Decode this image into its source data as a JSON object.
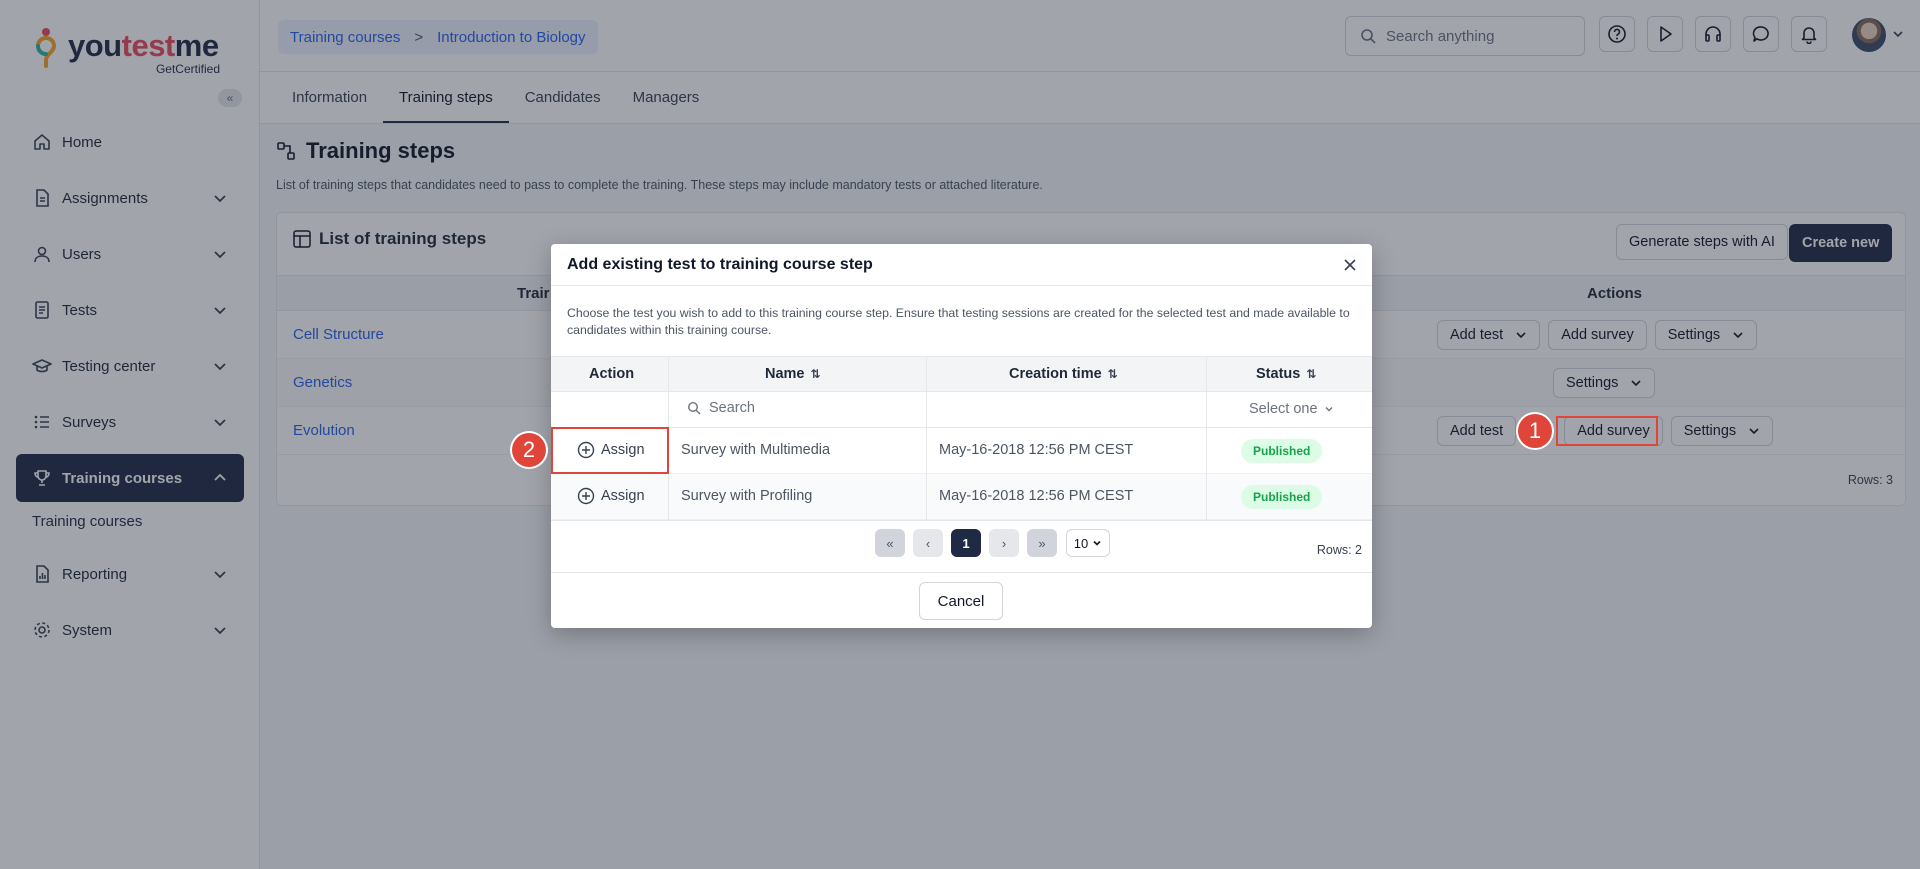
{
  "brand": {
    "logo_prefix": "you",
    "logo_mid": "test",
    "logo_suffix": "me",
    "sub": "GetCertified"
  },
  "sidebar": {
    "items": [
      {
        "label": "Home",
        "icon": "home-icon"
      },
      {
        "label": "Assignments",
        "icon": "document-icon"
      },
      {
        "label": "Users",
        "icon": "user-icon"
      },
      {
        "label": "Tests",
        "icon": "test-icon"
      },
      {
        "label": "Testing center",
        "icon": "graduation-cap-icon"
      },
      {
        "label": "Surveys",
        "icon": "list-icon"
      },
      {
        "label": "Training courses",
        "icon": "trophy-icon"
      },
      {
        "label": "Reporting",
        "icon": "report-icon"
      },
      {
        "label": "System",
        "icon": "gear-icon"
      }
    ],
    "sub_item": "Training courses"
  },
  "topbar": {
    "crumb1": "Training courses",
    "crumb_sep": ">",
    "crumb2": "Introduction to Biology",
    "search_placeholder": "Search anything"
  },
  "tabs": [
    "Information",
    "Training steps",
    "Candidates",
    "Managers"
  ],
  "page": {
    "title": "Training steps",
    "description": "List of training steps that candidates need to pass to complete the training. These steps may include mandatory tests or attached literature."
  },
  "card": {
    "title": "List of training steps",
    "generate_label": "Generate steps with AI",
    "create_label": "Create new",
    "col_training": "Trair",
    "col_actions": "Actions",
    "rows": [
      {
        "name": "Cell Structure"
      },
      {
        "name": "Genetics"
      },
      {
        "name": "Evolution"
      }
    ],
    "add_test": "Add test",
    "add_survey": "Add survey",
    "settings": "Settings",
    "rows_count": "Rows: 3"
  },
  "modal": {
    "title": "Add existing test to training course step",
    "description": "Choose the test you wish to add to this training course step. Ensure that testing sessions are created for the selected test and made available to candidates within this training course.",
    "columns": {
      "action": "Action",
      "name": "Name",
      "creation": "Creation time",
      "status": "Status"
    },
    "search_placeholder": "Search",
    "select_placeholder": "Select one",
    "rows": [
      {
        "action": "Assign",
        "name": "Survey with Multimedia",
        "created": "May-16-2018 12:56 PM CEST",
        "status": "Published"
      },
      {
        "action": "Assign",
        "name": "Survey with Profiling",
        "created": "May-16-2018 12:56 PM CEST",
        "status": "Published"
      }
    ],
    "pager": {
      "first": "«",
      "prev": "‹",
      "current": "1",
      "next": "›",
      "last": "»",
      "page_size": "10"
    },
    "rows_count": "Rows: 2",
    "cancel": "Cancel"
  },
  "annotations": {
    "step1": "1",
    "step2": "2",
    "color": "#e0453a"
  }
}
